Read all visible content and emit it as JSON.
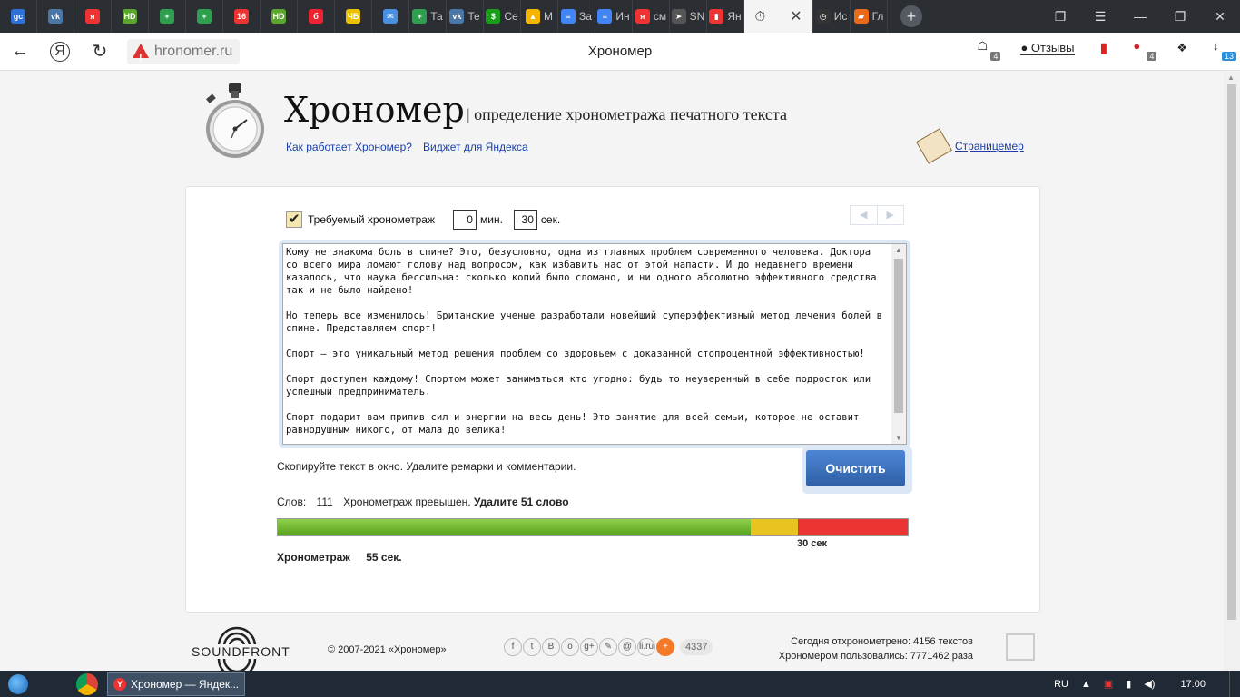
{
  "browser": {
    "tabs": [
      {
        "icon": "gc",
        "label": "",
        "color": "#2e6fd8"
      },
      {
        "icon": "vk",
        "label": "",
        "color": "#4a76a8"
      },
      {
        "icon": "я",
        "label": "",
        "color": "#e33"
      },
      {
        "icon": "HD",
        "label": "",
        "color": "#5ca52e"
      },
      {
        "icon": "+",
        "label": "",
        "color": "#2f9e4f"
      },
      {
        "icon": "+",
        "label": "",
        "color": "#2f9e4f"
      },
      {
        "icon": "16",
        "label": "",
        "color": "#e33"
      },
      {
        "icon": "HD",
        "label": "",
        "color": "#5ca52e"
      },
      {
        "icon": "б",
        "label": "",
        "color": "#e23"
      },
      {
        "icon": "ЧБ",
        "label": "",
        "color": "#e8c100"
      },
      {
        "icon": "✉",
        "label": "",
        "color": "#4a90e2"
      },
      {
        "icon": "+",
        "label": "Та",
        "color": "#2f9e4f"
      },
      {
        "icon": "vk",
        "label": "Те",
        "color": "#4a76a8"
      },
      {
        "icon": "$",
        "label": "Се",
        "color": "#1a9e1a"
      },
      {
        "icon": "▲",
        "label": "М",
        "color": "#f4b400"
      },
      {
        "icon": "≡",
        "label": "За",
        "color": "#4285f4"
      },
      {
        "icon": "≡",
        "label": "Ин",
        "color": "#4285f4"
      },
      {
        "icon": "я",
        "label": "см",
        "color": "#e33"
      },
      {
        "icon": "➤",
        "label": "SN",
        "color": "#555"
      },
      {
        "icon": "▮",
        "label": "Ян",
        "color": "#e33"
      }
    ],
    "active_tab_icon": "stopwatch-icon",
    "trailing_tabs": [
      {
        "icon": "◷",
        "label": "Ис",
        "color": "#333"
      },
      {
        "icon": "▰",
        "label": "Гл",
        "color": "#e86a1a"
      }
    ],
    "url": "hronomer.ru",
    "page_title": "Хрономер",
    "reviews_label": "Отзывы",
    "badge_tabs": "4",
    "badge_adblock": "4",
    "badge_downloads": "13"
  },
  "site": {
    "title": "Хрономер",
    "subtitle": "определение хронометража печатного текста",
    "link_how": "Как работает Хрономер?",
    "link_widget": "Виджет для Яндекса",
    "link_pagecounter": "Страницемер"
  },
  "form": {
    "required_label": "Требуемый хронометраж",
    "minutes_value": "0",
    "minutes_unit": "мин.",
    "seconds_value": "30",
    "seconds_unit": "сек.",
    "text": "Кому не знакома боль в спине? Это, безусловно, одна из главных проблем современного человека. Доктора со всего мира ломают голову над вопросом, как избавить нас от этой напасти. И до недавнего времени казалось, что наука бессильна: сколько копий было сломано, и ни одного абсолютно эффективного средства так и не было найдено!\n\nНо теперь все изменилось! Британские ученые разработали новейший суперэффективный метод лечения болей в спине. Представляем спорт!\n\nСпорт — это уникальный метод решения проблем со здоровьем с доказанной стопроцентной эффективностью!\n\nСпорт доступен каждому! Спортом может заниматься кто угодно: будь то неуверенный в себе подросток или успешный предприниматель.\n\nСпорт подарит вам прилив сил и энергии на весь день! Это занятие для всей семьи, которое не оставит равнодушным никого, от мала до велика!",
    "hint": "Скопируйте текст в окно. Удалите ремарки и комментарии.",
    "clear_label": "Очистить"
  },
  "result": {
    "words_label": "Слов:",
    "words_value": "111",
    "exceeded_text": "Хронометраж превышен.",
    "remove_text": "Удалите 51 слово",
    "limit_label": "30 сек",
    "duration_label": "Хронометраж",
    "duration_value": "55 сек.",
    "meter": {
      "green_fraction": 0.75,
      "yellow_fraction": 0.076,
      "colors": {
        "green": "#6cb52a",
        "yellow": "#e8c420",
        "red": "#ec3434"
      }
    }
  },
  "footer": {
    "brand": "SOUNDFRONT",
    "copyright": "© 2007-2021 «Хрономер»",
    "share_icons": [
      "f",
      "t",
      "B",
      "o",
      "g+",
      "✎",
      "@",
      "li.ru",
      "+"
    ],
    "share_count": "4337",
    "today_text": "Сегодня отхронометрено: 4156 текстов",
    "total_text": "Хрономером пользовались: 7771462 раза"
  },
  "taskbar": {
    "window_title": "Хрономер — Яндек...",
    "lang": "RU",
    "time": "17:00"
  }
}
